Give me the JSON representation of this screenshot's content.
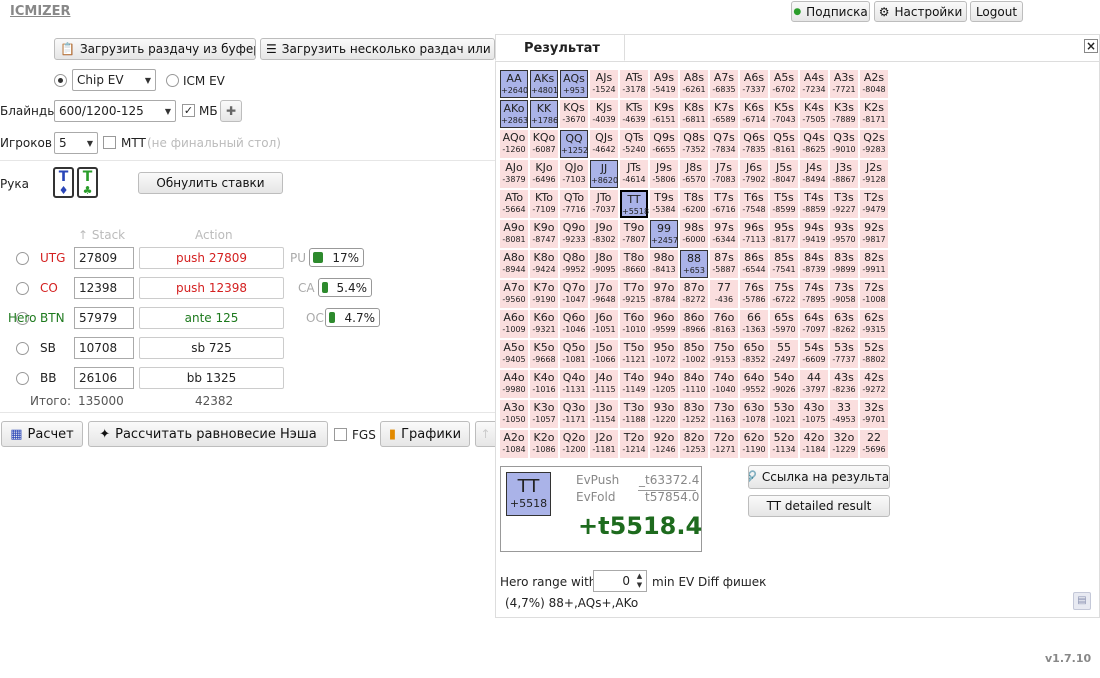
{
  "logo": "ICMIZER",
  "topbar": {
    "subscription": "Подписка",
    "settings": "Настройки",
    "logout": "Logout"
  },
  "load": {
    "from_clipboard": "Загрузить раздачу из буфера",
    "multiple": "Загрузить несколько раздач или тур"
  },
  "ev_mode": {
    "chip_ev": "Chip EV",
    "icm_ev": "ICM EV"
  },
  "blinds": {
    "label": "Блайнды",
    "value": "600/1200-125",
    "mb": "МБ"
  },
  "players": {
    "label": "Игроков",
    "value": "5",
    "mtt": "MTT",
    "mtt_note": "(не финальный стол)"
  },
  "hand": {
    "label": "Рука",
    "reset": "Обнулить ставки"
  },
  "columns": {
    "stack": "Stack",
    "action": "Action"
  },
  "positions": [
    {
      "hero": "",
      "pos": "UTG",
      "stack": "27809",
      "action": "push 27809",
      "color": "#d42020",
      "stat_label": "PU",
      "stat": "17%",
      "fill": 0.17
    },
    {
      "hero": "",
      "pos": "CO",
      "stack": "12398",
      "action": "push 12398",
      "color": "#d42020",
      "stat_label": "CA",
      "stat": "5.4%",
      "fill": 0.054
    },
    {
      "hero": "Hero",
      "pos": "BTN",
      "stack": "57979",
      "action": "ante 125",
      "color": "#1e7a1e",
      "stat_label": "OC",
      "stat": "4.7%",
      "fill": 0.047
    },
    {
      "hero": "",
      "pos": "SB",
      "stack": "10708",
      "action": "sb 725",
      "color": "#222",
      "stat_label": "",
      "stat": "",
      "fill": 0
    },
    {
      "hero": "",
      "pos": "BB",
      "stack": "26106",
      "action": "bb 1325",
      "color": "#222",
      "stat_label": "",
      "stat": "",
      "fill": 0
    }
  ],
  "totals": {
    "label": "Итого:",
    "stack": "135000",
    "action": "42382"
  },
  "bottom": {
    "calc": "Расчет",
    "nash": "Рассчитать равновесие Нэша",
    "fgs": "FGS",
    "charts": "Графики"
  },
  "result": {
    "tab": "Результат",
    "close": "×",
    "hand": "TT",
    "hand_ev": "+5518",
    "evpush_label": "EvPush",
    "evpush": "t63372.4",
    "evfold_label": "EvFold",
    "evfold": "t57854.0",
    "ev_diff": "+t5518.4",
    "link": "Ссылка на результат",
    "detailed": "TT detailed result",
    "range_label": "Hero range with",
    "range_value": "0",
    "range_suffix": "min EV Diff фишек",
    "range_summary": "(4,7%) 88+,AQs+,AKo"
  },
  "version": "v1.7.10",
  "grid": [
    [
      "AA",
      "+2640"
    ],
    [
      "AKs",
      "+4801"
    ],
    [
      "AQs",
      "+953"
    ],
    [
      "AJs",
      "-1524"
    ],
    [
      "ATs",
      "-3178"
    ],
    [
      "A9s",
      "-5419"
    ],
    [
      "A8s",
      "-6261"
    ],
    [
      "A7s",
      "-6835"
    ],
    [
      "A6s",
      "-7337"
    ],
    [
      "A5s",
      "-6702"
    ],
    [
      "A4s",
      "-7234"
    ],
    [
      "A3s",
      "-7721"
    ],
    [
      "A2s",
      "-8048"
    ],
    [
      "AKo",
      "+2863"
    ],
    [
      "KK",
      "+1786"
    ],
    [
      "KQs",
      "-3670"
    ],
    [
      "KJs",
      "-4039"
    ],
    [
      "KTs",
      "-4639"
    ],
    [
      "K9s",
      "-6151"
    ],
    [
      "K8s",
      "-6811"
    ],
    [
      "K7s",
      "-6589"
    ],
    [
      "K6s",
      "-6714"
    ],
    [
      "K5s",
      "-7043"
    ],
    [
      "K4s",
      "-7505"
    ],
    [
      "K3s",
      "-7889"
    ],
    [
      "K2s",
      "-8171"
    ],
    [
      "AQo",
      "-1260"
    ],
    [
      "KQo",
      "-6087"
    ],
    [
      "QQ",
      "+1252"
    ],
    [
      "QJs",
      "-4642"
    ],
    [
      "QTs",
      "-5240"
    ],
    [
      "Q9s",
      "-6655"
    ],
    [
      "Q8s",
      "-7352"
    ],
    [
      "Q7s",
      "-7834"
    ],
    [
      "Q6s",
      "-7835"
    ],
    [
      "Q5s",
      "-8161"
    ],
    [
      "Q4s",
      "-8625"
    ],
    [
      "Q3s",
      "-9010"
    ],
    [
      "Q2s",
      "-9283"
    ],
    [
      "AJo",
      "-3879"
    ],
    [
      "KJo",
      "-6496"
    ],
    [
      "QJo",
      "-7103"
    ],
    [
      "JJ",
      "+8620"
    ],
    [
      "JTs",
      "-4614"
    ],
    [
      "J9s",
      "-5806"
    ],
    [
      "J8s",
      "-6570"
    ],
    [
      "J7s",
      "-7083"
    ],
    [
      "J6s",
      "-7902"
    ],
    [
      "J5s",
      "-8047"
    ],
    [
      "J4s",
      "-8494"
    ],
    [
      "J3s",
      "-8867"
    ],
    [
      "J2s",
      "-9128"
    ],
    [
      "ATo",
      "-5664"
    ],
    [
      "KTo",
      "-7109"
    ],
    [
      "QTo",
      "-7716"
    ],
    [
      "JTo",
      "-7037"
    ],
    [
      "TT",
      "+5518"
    ],
    [
      "T9s",
      "-5384"
    ],
    [
      "T8s",
      "-6200"
    ],
    [
      "T7s",
      "-6716"
    ],
    [
      "T6s",
      "-7548"
    ],
    [
      "T5s",
      "-8599"
    ],
    [
      "T4s",
      "-8859"
    ],
    [
      "T3s",
      "-9227"
    ],
    [
      "T2s",
      "-9479"
    ],
    [
      "A9o",
      "-8081"
    ],
    [
      "K9o",
      "-8747"
    ],
    [
      "Q9o",
      "-9233"
    ],
    [
      "J9o",
      "-8302"
    ],
    [
      "T9o",
      "-7807"
    ],
    [
      "99",
      "+2457"
    ],
    [
      "98s",
      "-6000"
    ],
    [
      "97s",
      "-6344"
    ],
    [
      "96s",
      "-7113"
    ],
    [
      "95s",
      "-8177"
    ],
    [
      "94s",
      "-9419"
    ],
    [
      "93s",
      "-9570"
    ],
    [
      "92s",
      "-9817"
    ],
    [
      "A8o",
      "-8944"
    ],
    [
      "K8o",
      "-9424"
    ],
    [
      "Q8o",
      "-9952"
    ],
    [
      "J8o",
      "-9095"
    ],
    [
      "T8o",
      "-8660"
    ],
    [
      "98o",
      "-8413"
    ],
    [
      "88",
      "+653"
    ],
    [
      "87s",
      "-5887"
    ],
    [
      "86s",
      "-6544"
    ],
    [
      "85s",
      "-7541"
    ],
    [
      "84s",
      "-8739"
    ],
    [
      "83s",
      "-9899"
    ],
    [
      "82s",
      "-9911"
    ],
    [
      "A7o",
      "-9560"
    ],
    [
      "K7o",
      "-9190"
    ],
    [
      "Q7o",
      "-1047"
    ],
    [
      "J7o",
      "-9648"
    ],
    [
      "T7o",
      "-9215"
    ],
    [
      "97o",
      "-8784"
    ],
    [
      "87o",
      "-8272"
    ],
    [
      "77",
      "-436"
    ],
    [
      "76s",
      "-5786"
    ],
    [
      "75s",
      "-6722"
    ],
    [
      "74s",
      "-7895"
    ],
    [
      "73s",
      "-9058"
    ],
    [
      "72s",
      "-1008"
    ],
    [
      "A6o",
      "-1009"
    ],
    [
      "K6o",
      "-9321"
    ],
    [
      "Q6o",
      "-1046"
    ],
    [
      "J6o",
      "-1051"
    ],
    [
      "T6o",
      "-1010"
    ],
    [
      "96o",
      "-9599"
    ],
    [
      "86o",
      "-8966"
    ],
    [
      "76o",
      "-8163"
    ],
    [
      "66",
      "-1363"
    ],
    [
      "65s",
      "-5970"
    ],
    [
      "64s",
      "-7097"
    ],
    [
      "63s",
      "-8262"
    ],
    [
      "62s",
      "-9315"
    ],
    [
      "A5o",
      "-9405"
    ],
    [
      "K5o",
      "-9668"
    ],
    [
      "Q5o",
      "-1081"
    ],
    [
      "J5o",
      "-1066"
    ],
    [
      "T5o",
      "-1121"
    ],
    [
      "95o",
      "-1072"
    ],
    [
      "85o",
      "-1002"
    ],
    [
      "75o",
      "-9153"
    ],
    [
      "65o",
      "-8352"
    ],
    [
      "55",
      "-2497"
    ],
    [
      "54s",
      "-6609"
    ],
    [
      "53s",
      "-7737"
    ],
    [
      "52s",
      "-8802"
    ],
    [
      "A4o",
      "-9980"
    ],
    [
      "K4o",
      "-1016"
    ],
    [
      "Q4o",
      "-1131"
    ],
    [
      "J4o",
      "-1115"
    ],
    [
      "T4o",
      "-1149"
    ],
    [
      "94o",
      "-1205"
    ],
    [
      "84o",
      "-1110"
    ],
    [
      "74o",
      "-1040"
    ],
    [
      "64o",
      "-9552"
    ],
    [
      "54o",
      "-9026"
    ],
    [
      "44",
      "-3797"
    ],
    [
      "43s",
      "-8236"
    ],
    [
      "42s",
      "-9272"
    ],
    [
      "A3o",
      "-1050"
    ],
    [
      "K3o",
      "-1057"
    ],
    [
      "Q3o",
      "-1171"
    ],
    [
      "J3o",
      "-1154"
    ],
    [
      "T3o",
      "-1188"
    ],
    [
      "93o",
      "-1220"
    ],
    [
      "83o",
      "-1252"
    ],
    [
      "73o",
      "-1163"
    ],
    [
      "63o",
      "-1078"
    ],
    [
      "53o",
      "-1021"
    ],
    [
      "43o",
      "-1075"
    ],
    [
      "33",
      "-4953"
    ],
    [
      "32s",
      "-9701"
    ],
    [
      "A2o",
      "-1084"
    ],
    [
      "K2o",
      "-1086"
    ],
    [
      "Q2o",
      "-1200"
    ],
    [
      "J2o",
      "-1181"
    ],
    [
      "T2o",
      "-1214"
    ],
    [
      "92o",
      "-1246"
    ],
    [
      "82o",
      "-1253"
    ],
    [
      "72o",
      "-1271"
    ],
    [
      "62o",
      "-1190"
    ],
    [
      "52o",
      "-1134"
    ],
    [
      "42o",
      "-1184"
    ],
    [
      "32o",
      "-1229"
    ],
    [
      "22",
      "-5696"
    ]
  ],
  "selected": [
    "AA",
    "AKs",
    "AQs",
    "AKo",
    "KK",
    "QQ",
    "JJ",
    "TT",
    "99",
    "88"
  ],
  "current": "TT"
}
